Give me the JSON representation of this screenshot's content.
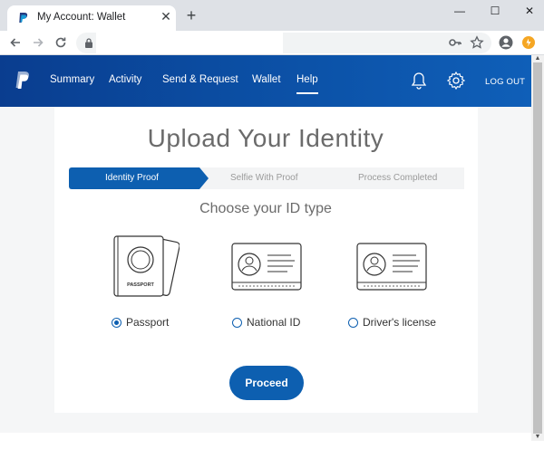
{
  "browser": {
    "tab_title": "My Account: Wallet",
    "close_tab": "✕",
    "new_tab": "+",
    "minimize": "—",
    "maximize": "☐",
    "close_window": "✕"
  },
  "header": {
    "nav": [
      "Summary",
      "Activity",
      "Send & Request",
      "Wallet",
      "Help"
    ],
    "active_nav": "Help",
    "logout_label": "LOG OUT"
  },
  "main": {
    "title": "Upload Your Identity",
    "steps": [
      "Identity Proof",
      "Selfie With Proof",
      "Process Completed"
    ],
    "active_step": "Identity Proof",
    "choose_title": "Choose your ID type",
    "id_types": [
      {
        "label": "Passport",
        "selected": true,
        "illustration_text": "PASSPORT"
      },
      {
        "label": "National ID",
        "selected": false
      },
      {
        "label": "Driver's license",
        "selected": false
      }
    ],
    "proceed_label": "Proceed"
  },
  "colors": {
    "brand_blue": "#0d5fb0",
    "header_dark": "#0a3d8f"
  }
}
